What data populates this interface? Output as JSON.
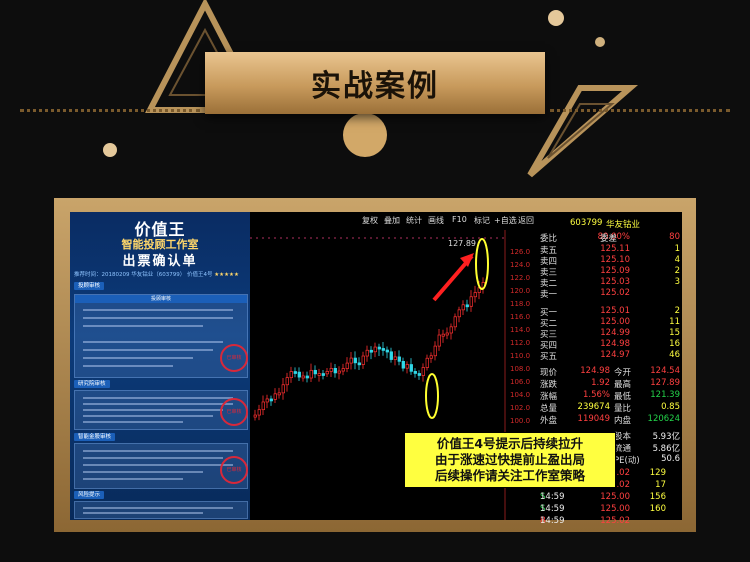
{
  "banner": {
    "title": "实战案例"
  },
  "card": {
    "brand": "价值王",
    "subtitle": "智能投顾工作室",
    "title": "出票确认单",
    "meta": "推荐时间：20180209  华友钴业（603799）  价值王4号",
    "stars": "★★★★★",
    "sections": [
      "投顾审核",
      "研究院审核",
      "智能金股审核",
      "风险提示"
    ],
    "review_header": "投顾审核",
    "stamp": "已审核"
  },
  "toolbar": {
    "items": [
      "复权",
      "叠加",
      "统计",
      "画线",
      "F10",
      "标记",
      "+自选",
      "返回"
    ]
  },
  "chart": {
    "price_labels": [
      "126.0",
      "124.0",
      "122.0",
      "120.0",
      "118.0",
      "116.0",
      "114.0",
      "112.0",
      "110.0",
      "108.0",
      "106.0",
      "104.0",
      "102.0",
      "100.0"
    ],
    "high_label": "127.89"
  },
  "quote": {
    "code": "603799",
    "name": "华友钴业",
    "weibi": {
      "label": "委比",
      "value": "80.00%",
      "label2": "委差",
      "value2": "80"
    },
    "asks": [
      {
        "label": "卖五",
        "price": "125.11",
        "vol": "1"
      },
      {
        "label": "卖四",
        "price": "125.10",
        "vol": "4"
      },
      {
        "label": "卖三",
        "price": "125.09",
        "vol": "2"
      },
      {
        "label": "卖二",
        "price": "125.03",
        "vol": "3"
      },
      {
        "label": "卖一",
        "price": "125.02",
        "vol": ""
      }
    ],
    "bids": [
      {
        "label": "买一",
        "price": "125.01",
        "vol": "2"
      },
      {
        "label": "买二",
        "price": "125.00",
        "vol": "11"
      },
      {
        "label": "买三",
        "price": "124.99",
        "vol": "15"
      },
      {
        "label": "买四",
        "price": "124.98",
        "vol": "16"
      },
      {
        "label": "买五",
        "price": "124.97",
        "vol": "46"
      }
    ],
    "stats": [
      {
        "l1": "现价",
        "v1": "124.98",
        "l2": "今开",
        "v2": "124.54"
      },
      {
        "l1": "涨跌",
        "v1": "1.92",
        "l2": "最高",
        "v2": "127.89"
      },
      {
        "l1": "涨幅",
        "v1": "1.56%",
        "l2": "最低",
        "v2": "121.39"
      },
      {
        "l1": "总量",
        "v1": "239674",
        "l2": "量比",
        "v2": "0.85"
      },
      {
        "l1": "外盘",
        "v1": "119049",
        "l2": "内盘",
        "v2": "120624"
      }
    ],
    "extra": [
      {
        "label": "股本",
        "value": "5.93亿"
      },
      {
        "label": "流通",
        "value": "5.86亿"
      },
      {
        "label": "PE(动)",
        "value": "50.6"
      }
    ],
    "ticks": [
      {
        "time": "",
        "price": "125.02",
        "vol": "129",
        "flag": "S"
      },
      {
        "time": "",
        "price": "125.02",
        "vol": "17",
        "flag": "S"
      },
      {
        "time": "14:59",
        "price": "125.00",
        "vol": "156",
        "flag": "S"
      },
      {
        "time": "14:59",
        "price": "125.00",
        "vol": "160",
        "flag": "S"
      },
      {
        "time": "14:59",
        "price": "125.02",
        "vol": "",
        "flag": "B"
      }
    ]
  },
  "callout": {
    "line1": "价值王4号提示后持续拉升",
    "line2": "由于涨速过快提前止盈出局",
    "line3": "后续操作请关注工作室策略"
  }
}
